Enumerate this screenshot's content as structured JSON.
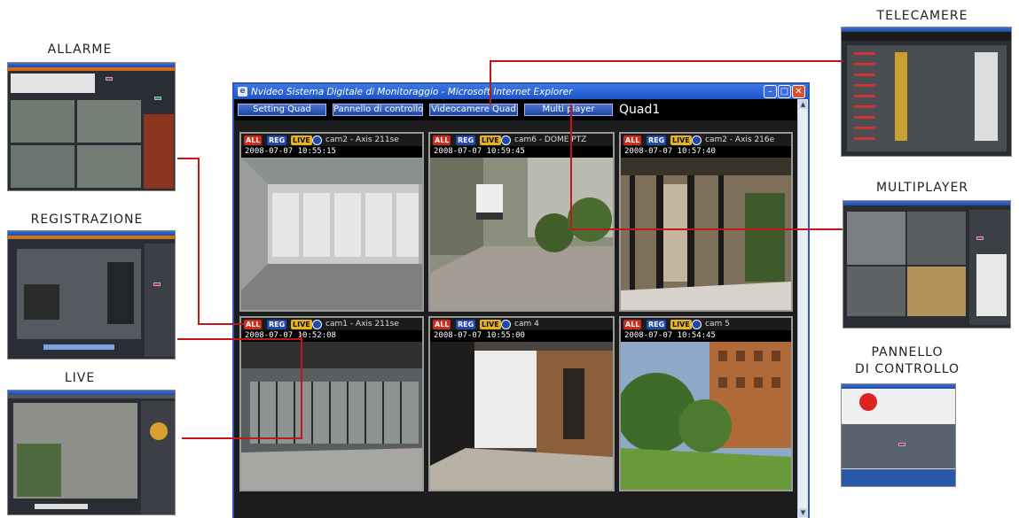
{
  "captions": {
    "allarme": "ALLARME",
    "registrazione": "REGISTRAZIONE",
    "live": "LIVE",
    "telecamere": "TELECAMERE",
    "multiplayer": "MULTIPLAYER",
    "pannello_line1": "PANNELLO",
    "pannello_line2": "DI CONTROLLO"
  },
  "window": {
    "title": "Nvideo Sistema Digitale di Monitoraggio - Microsoft Internet Explorer",
    "toolbar": [
      {
        "label": "Setting Quad"
      },
      {
        "label": "Pannello di controllo"
      },
      {
        "label": "Videocamere Quad"
      },
      {
        "label": "Multi player"
      }
    ],
    "quad_label": "Quad1"
  },
  "badges": {
    "all": "ALL",
    "reg": "REG",
    "live": "LIVE"
  },
  "tiles": [
    {
      "cam": "cam2 - Axis 211se",
      "timestamp": "2008-07-07 10:55:15",
      "scene": "garage-corridor"
    },
    {
      "cam": "cam6 - DOME PTZ",
      "timestamp": "2008-07-07 10:59:45",
      "scene": "courtyard-van"
    },
    {
      "cam": "cam2 - Axis 216e",
      "timestamp": "2008-07-07 10:57:40",
      "scene": "lobby-door"
    },
    {
      "cam": "cam1 - Axis 211se",
      "timestamp": "2008-07-07 10:52:08",
      "scene": "garage-gate"
    },
    {
      "cam": "cam 4",
      "timestamp": "2008-07-07 10:55:00",
      "scene": "stairwell"
    },
    {
      "cam": "cam 5",
      "timestamp": "2008-07-07 10:54:45",
      "scene": "building-garden"
    }
  ],
  "colors": {
    "connector": "#c01818",
    "titlebar": "#2b55b8",
    "badge_all": "#d42a1a",
    "badge_reg": "#1f47b0",
    "badge_live": "#e6b41c"
  }
}
